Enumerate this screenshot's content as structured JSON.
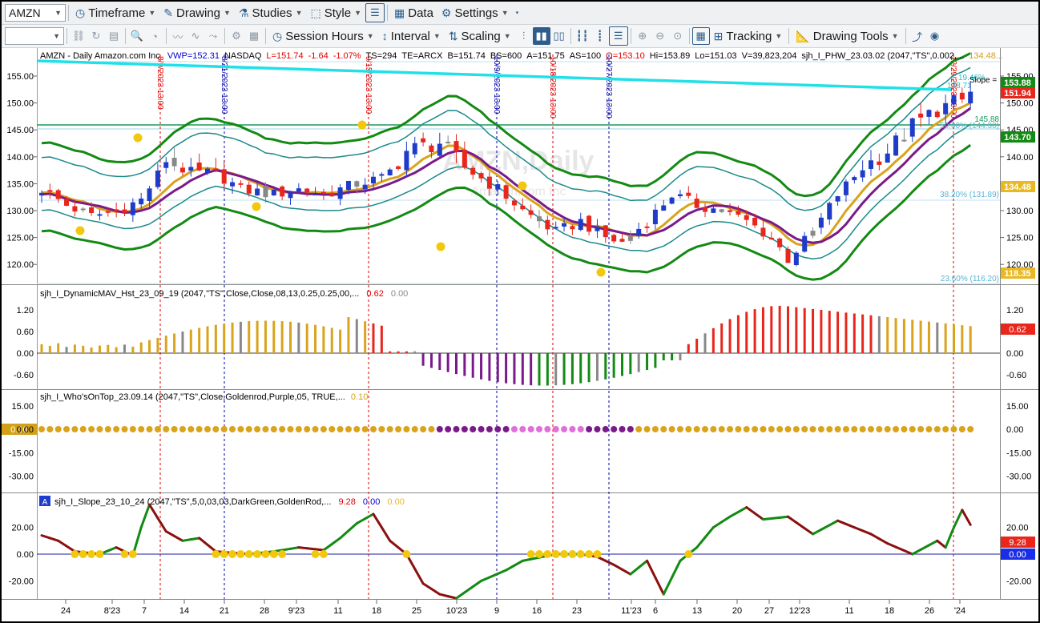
{
  "toolbar1": {
    "symbol": "AMZN",
    "items": [
      {
        "label": "Timeframe",
        "icon": "clock-icon"
      },
      {
        "label": "Drawing",
        "icon": "pen-icon"
      },
      {
        "label": "Studies",
        "icon": "flask-icon"
      },
      {
        "label": "Style",
        "icon": "style-icon"
      },
      {
        "label": "Data",
        "icon": "data-grid-icon"
      },
      {
        "label": "Settings",
        "icon": "gear-icon"
      }
    ]
  },
  "toolbar2": {
    "combo_value": "",
    "session_hours": "Session Hours",
    "interval": "Interval",
    "scaling": "Scaling",
    "tracking": "Tracking",
    "drawing_tools": "Drawing Tools"
  },
  "main_panel": {
    "header_symbol": "AMZN - Daily  Amazon.com Inc",
    "header_fields": [
      {
        "text": "VWP=152.31",
        "color": "#0000cc"
      },
      {
        "text": "NASDAQ",
        "color": "#000000"
      },
      {
        "text": "L=151.74",
        "color": "#e00000"
      },
      {
        "text": "-1.64",
        "color": "#e00000"
      },
      {
        "text": "-1.07%",
        "color": "#e00000"
      },
      {
        "text": "TS=294",
        "color": "#000000"
      },
      {
        "text": "TE=ARCX",
        "color": "#000000"
      },
      {
        "text": "B=151.74",
        "color": "#000000"
      },
      {
        "text": "BS=600",
        "color": "#000000"
      },
      {
        "text": "A=151.75",
        "color": "#000000"
      },
      {
        "text": "AS=100",
        "color": "#000000"
      },
      {
        "text": "O=153.10",
        "color": "#e00000"
      },
      {
        "text": "Hi=153.89",
        "color": "#000000"
      },
      {
        "text": "Lo=151.03",
        "color": "#000000"
      },
      {
        "text": "V=39,823,204",
        "color": "#000000"
      },
      {
        "text": "sjh_I_PHW_23.03.02 (2047,\"TS\",0.002,...",
        "color": "#000000"
      },
      {
        "text": "134.48...",
        "color": "#d4a017"
      }
    ],
    "watermark_symbol": "AMZN,Daily",
    "watermark_name": "Amazon.com Inc",
    "y_ticks": [
      "155.00",
      "150.00",
      "145.00",
      "140.00",
      "135.00",
      "130.00",
      "125.00",
      "120.00"
    ],
    "price_tags": [
      {
        "text": "153.88",
        "bg": "#138a13",
        "fg": "#ffffff"
      },
      {
        "text": "151.94",
        "bg": "#e8261c",
        "fg": "#ffffff"
      },
      {
        "text": "143.70",
        "bg": "#138a13",
        "fg": "#ffffff"
      },
      {
        "text": "134.48",
        "bg": "#e8b923",
        "fg": "#ffffff"
      },
      {
        "text": "118.35",
        "bg": "#e8b923",
        "fg": "#ffffff"
      }
    ],
    "fib_labels": [
      "19.46%",
      "138.71",
      "Slope =",
      "145.88",
      "50.00% (144.30)",
      "38.20% (131.89)",
      "23.60% (116.20)"
    ],
    "vertical_markers": [
      {
        "text": "8/9/2023 13:00",
        "color": "#e00000"
      },
      {
        "text": "8/21/2023 13:00",
        "color": "#0000aa"
      },
      {
        "text": "9/15/2023 13:00",
        "color": "#e00000"
      },
      {
        "text": "10/9/2023 13:00",
        "color": "#0000aa"
      },
      {
        "text": "10/18/2023 13:00",
        "color": "#e00000"
      },
      {
        "text": "10/27/2023 13:00",
        "color": "#0000aa"
      },
      {
        "text": "12/29/2023 13:00",
        "color": "#e00000"
      }
    ]
  },
  "panel_mav": {
    "title": "sjh_I_DynamicMAV_Hst_23_09_19 (2047,\"TS\",Close,Close,08,13,0.25,0.25,00,...",
    "value1": "0.62",
    "value2": "0.00",
    "y_ticks": [
      "1.20",
      "0.60",
      "0.00",
      "-0.60"
    ],
    "tag": "0.62"
  },
  "panel_who": {
    "title": "sjh_I_Who'sOnTop_23.09.14 (2047,\"TS\",Close,Goldenrod,Purple,05,  TRUE,...",
    "value": "0.10",
    "left_tag": "0.10",
    "y_ticks": [
      "15.00",
      "0.00",
      "-15.00",
      "-30.00"
    ]
  },
  "panel_slope": {
    "badge": "A",
    "title": "sjh_I_Slope_23_10_24 (2047,\"TS\",5,0,03,03,DarkGreen,GoldenRod,...",
    "value1": "9.28",
    "value2": "0.00",
    "value3": "0.00",
    "y_ticks": [
      "20.00",
      "0.00",
      "-20.00"
    ],
    "tag1": "9.28",
    "tag2": "0.00"
  },
  "x_axis": [
    "24",
    "8'23",
    "7",
    "14",
    "21",
    "28",
    "9'23",
    "11",
    "18",
    "25",
    "10'23",
    "9",
    "16",
    "23",
    "11'23",
    "6",
    "13",
    "20",
    "27",
    "12'23",
    "11",
    "18",
    "26",
    "'24"
  ],
  "colors": {
    "up": "#1e3cc8",
    "down": "#e8261c",
    "band_green": "#138a13",
    "band_teal": "#1a8a8a",
    "gold": "#d9a31c",
    "purple": "#7a1a8a",
    "cyan": "#22e0e8"
  },
  "chart_data": {
    "type": "line",
    "title": "AMZN - Daily  Amazon.com Inc",
    "x_range": [
      "2023-07-24",
      "2023-12-29"
    ],
    "ylim": [
      116,
      157
    ],
    "last_close": 151.94,
    "indicator_values": {
      "dynamic_mav": 0.62,
      "whos_on_top": 0.1,
      "slope": 9.28
    }
  }
}
